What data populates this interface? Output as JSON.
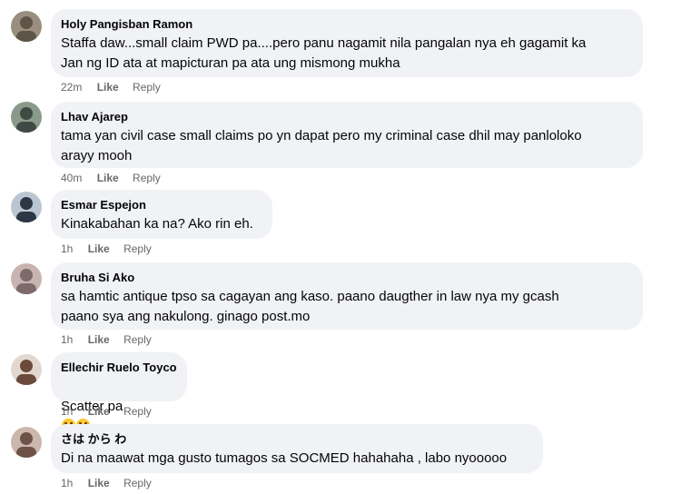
{
  "comments": [
    {
      "author": "Holy Pangisban Ramon",
      "text": "Staffa daw...small claim PWD pa....pero panu nagamit nila pangalan nya eh gagamit ka\nJan ng ID ata at mapicturan pa ata ung mismong mukha",
      "time": "22m",
      "like": "Like",
      "reply": "Reply",
      "avatar_colors": [
        "#9a8f7e",
        "#5c5548"
      ]
    },
    {
      "author": "Lhav Ajarep",
      "text": "tama yan civil case small claims po yn dapat pero my criminal case dhil may panloloko\narayy mooh",
      "time": "40m",
      "like": "Like",
      "reply": "Reply",
      "avatar_colors": [
        "#8a9a8a",
        "#3f4a44"
      ]
    },
    {
      "author": "Esmar Espejon",
      "text": "Kinakabahan ka na? Ako rin eh.",
      "time": "1h",
      "like": "Like",
      "reply": "Reply",
      "avatar_colors": [
        "#b9c6d2",
        "#2c3645"
      ]
    },
    {
      "author": "Bruha Si Ako",
      "text": "sa hamtic antique tpso sa cagayan ang kaso. paano daugther in law nya my gcash\npaano sya ang nakulong. ginago post.mo",
      "time": "1h",
      "like": "Like",
      "reply": "Reply",
      "avatar_colors": [
        "#c7b4b0",
        "#7d6a6a"
      ]
    },
    {
      "author": "Ellechir Ruelo Toyco",
      "text": "Scatter pa",
      "time": "1h",
      "like": "Like",
      "reply": "Reply",
      "emoji_count": 2,
      "avatar_colors": [
        "#e3d8d0",
        "#6b4a3c"
      ]
    },
    {
      "author": "さは から わ",
      "text": "Di na maawat mga gusto tumagos sa SOCMED hahahaha , labo nyooooo",
      "time": "1h",
      "like": "Like",
      "reply": "Reply",
      "avatar_colors": [
        "#cbb7ae",
        "#6e5248"
      ]
    }
  ]
}
